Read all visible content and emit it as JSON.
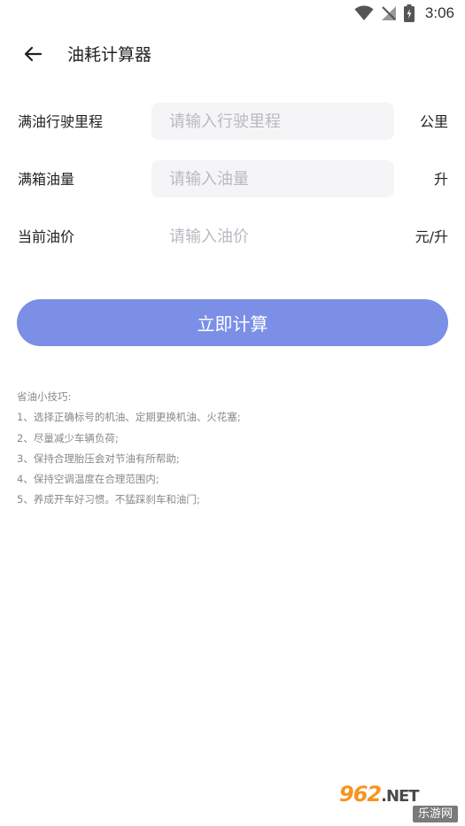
{
  "status_bar": {
    "time": "3:06",
    "icons": [
      "wifi-icon",
      "no-signal-icon",
      "battery-charging-icon"
    ]
  },
  "header": {
    "back_icon": "arrow-left-icon",
    "title": "油耗计算器"
  },
  "form": {
    "rows": [
      {
        "label": "满油行驶里程",
        "placeholder": "请输入行驶里程",
        "value": "",
        "unit": "公里"
      },
      {
        "label": "满箱油量",
        "placeholder": "请输入油量",
        "value": "",
        "unit": "升"
      },
      {
        "label": "当前油价",
        "placeholder": "请输入油价",
        "value": "",
        "unit": "元/升"
      }
    ]
  },
  "calculate_button": {
    "label": "立即计算",
    "color": "#7b8fe6"
  },
  "tips": {
    "title": "省油小技巧:",
    "items": [
      "1、选择正确标号的机油、定期更换机油、火花塞;",
      "2、尽量减少车辆负荷;",
      "3、保持合理胎压会对节油有所帮助;",
      "4、保持空调温度在合理范围内;",
      "5、养成开车好习惯。不猛踩刹车和油门;"
    ]
  },
  "watermark": {
    "logo": "962",
    "suffix": ".NET",
    "sub": "乐游网"
  }
}
